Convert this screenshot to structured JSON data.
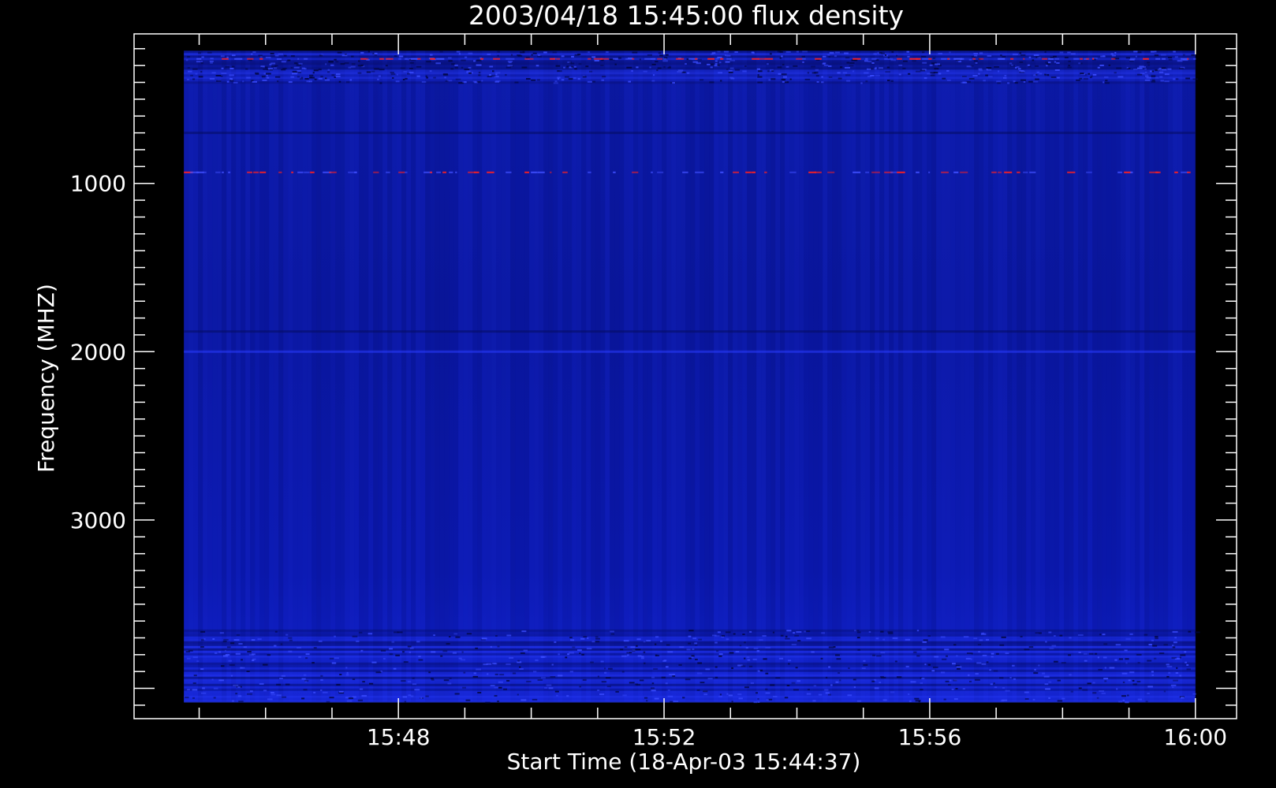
{
  "chart_data": {
    "type": "heatmap",
    "title": "2003/04/18 15:45:00 flux density",
    "xlabel": "Start Time (18-Apr-03 15:44:37)",
    "ylabel": "Frequency (MHZ)",
    "x_ticks": [
      {
        "label": "15:48",
        "minutes": 3.38
      },
      {
        "label": "15:52",
        "minutes": 7.38
      },
      {
        "label": "15:56",
        "minutes": 11.38
      },
      {
        "label": "16:00",
        "minutes": 15.38
      }
    ],
    "y_ticks": [
      1000,
      2000,
      3000
    ],
    "xlim_minutes": [
      -0.6,
      16.0
    ],
    "ylim": [
      112,
      4180
    ],
    "y_inverted": true,
    "data_x_range_minutes": [
      0.15,
      15.38
    ],
    "data_y_range": [
      212,
      4080
    ],
    "colors": {
      "background": "#000000",
      "axis": "#ffffff",
      "base": "#0a18a8",
      "bright": "#2a3cff",
      "dark": "#060c60",
      "hot": "#ff2020"
    },
    "features": [
      {
        "kind": "band",
        "freq_start": 212,
        "freq_end": 400,
        "intensity": "bright",
        "note": "noisy strip near top"
      },
      {
        "kind": "line",
        "freq": 256,
        "color": "hot"
      },
      {
        "kind": "line",
        "freq": 700,
        "color": "dark"
      },
      {
        "kind": "line",
        "freq": 930,
        "color": "hot"
      },
      {
        "kind": "line",
        "freq": 1880,
        "color": "dark"
      },
      {
        "kind": "line",
        "freq": 2000,
        "color": "bright"
      },
      {
        "kind": "band",
        "freq_start": 3650,
        "freq_end": 4080,
        "intensity": "bright",
        "note": "noisy strip near bottom"
      }
    ]
  }
}
